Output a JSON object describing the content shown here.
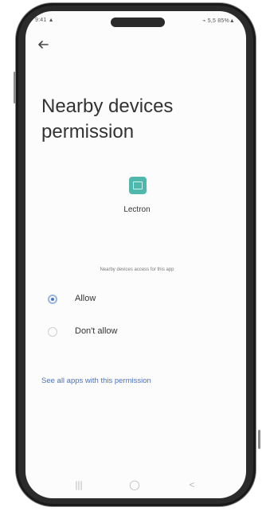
{
  "status_bar": {
    "left_text": "9:41 ▲",
    "right_text": "⌁ 5,5 85%▲"
  },
  "header": {
    "title": "Nearby devices permission"
  },
  "app": {
    "name": "Lectron",
    "icon": "app-window-icon",
    "icon_color": "#4fb8ad"
  },
  "permission": {
    "section_label": "Nearby devices access for this app",
    "options": [
      {
        "label": "Allow",
        "selected": true
      },
      {
        "label": "Don't allow",
        "selected": false
      }
    ],
    "see_all_link": "See all apps with this permission"
  },
  "navbar": {
    "recent_glyph": "|||",
    "home_glyph": "◯",
    "back_glyph": "<"
  },
  "colors": {
    "accent": "#4a76c9",
    "link": "#4d72c2",
    "frame": "#2b2b2b"
  }
}
